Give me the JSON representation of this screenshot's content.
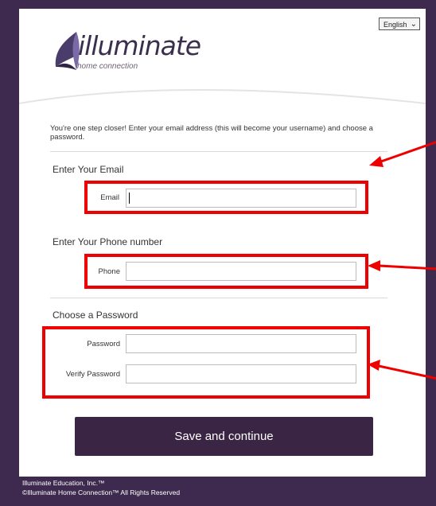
{
  "language": {
    "selected": "English"
  },
  "brand": {
    "name": "illuminate",
    "sub": "home connection"
  },
  "intro": "You're one step closer! Enter your email address (this will become your username) and choose a password.",
  "sections": {
    "email": {
      "title": "Enter Your Email",
      "label": "Email",
      "value": ""
    },
    "phone": {
      "title": "Enter Your Phone number",
      "label": "Phone",
      "value": ""
    },
    "password": {
      "title": "Choose a Password",
      "password_label": "Password",
      "verify_label": "Verify Password"
    }
  },
  "submit": {
    "label": "Save and continue"
  },
  "footer": {
    "line1": "Illuminate Education, Inc.™",
    "line2": "©Illuminate Home Connection™ All Rights Reserved"
  },
  "colors": {
    "background": "#3d2a4e",
    "button": "#3a2644",
    "highlight": "#ee0000"
  }
}
